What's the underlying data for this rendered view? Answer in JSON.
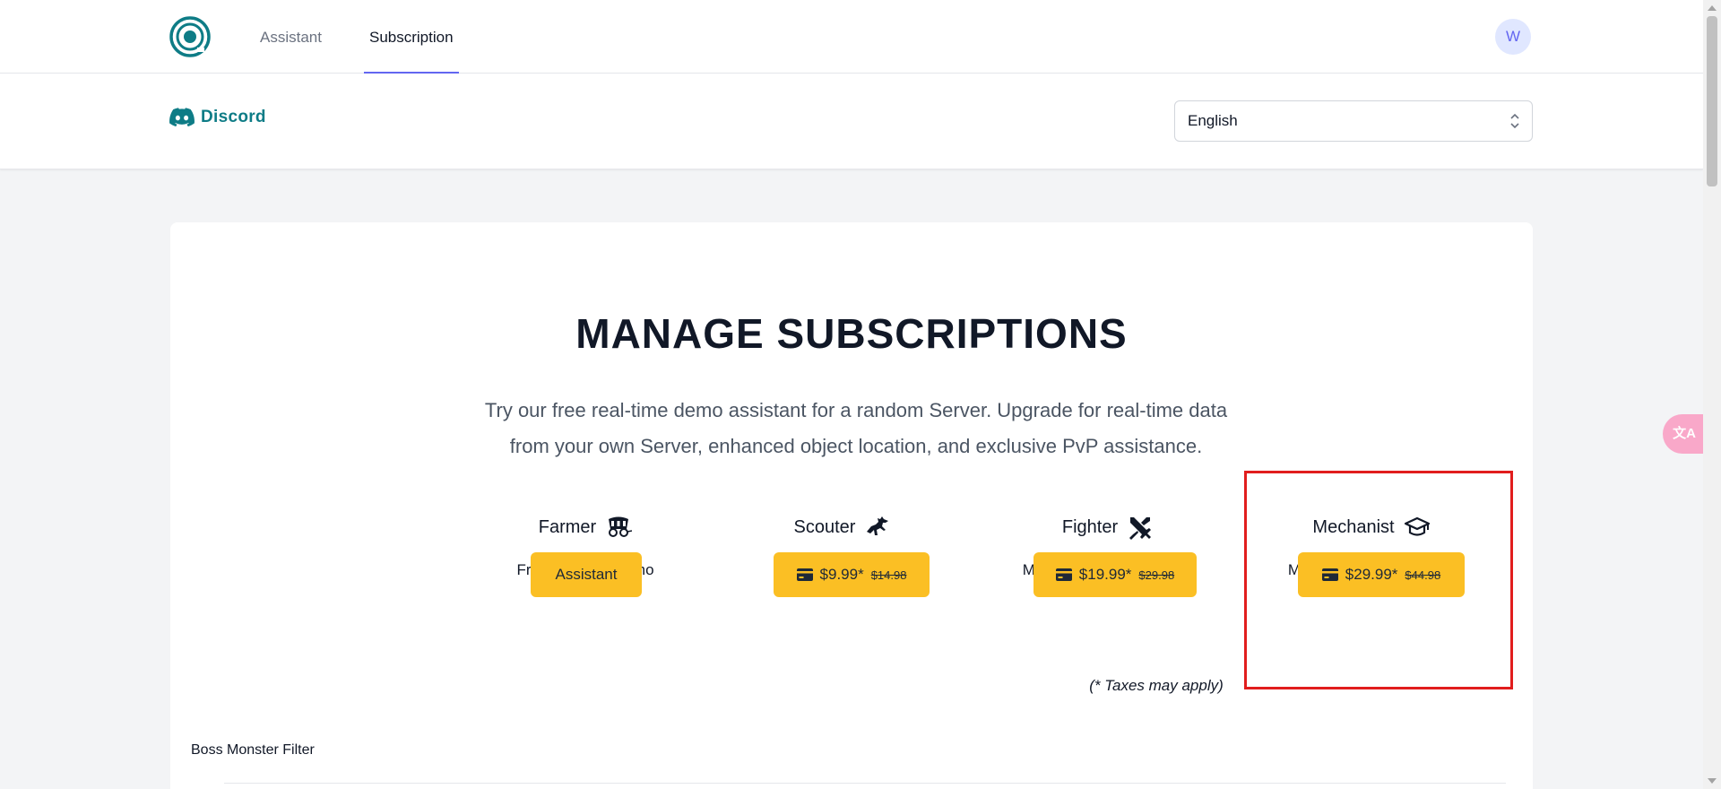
{
  "nav": {
    "tabs": [
      {
        "label": "Assistant"
      },
      {
        "label": "Subscription"
      }
    ],
    "avatar_initial": "W"
  },
  "subbar": {
    "discord_label": "Discord",
    "language": {
      "value": "English"
    }
  },
  "main": {
    "title": "MANAGE SUBSCRIPTIONS",
    "description": "Try our free real-time demo assistant for a random Server. Upgrade for real-time data from your own Server, enhanced object location, and exclusive PvP assistance.",
    "plans": [
      {
        "name": "Farmer",
        "icon": "wagon-icon",
        "subtitle": "Free real-time demo",
        "button_label": "Assistant"
      },
      {
        "name": "Scouter",
        "icon": "horse-rider-icon",
        "subtitle": "Monthly subscription",
        "price": "$9.99*",
        "old_price": "$14.98"
      },
      {
        "name": "Fighter",
        "icon": "crossed-swords-icon",
        "subtitle": "Monthly PvP subscription",
        "price": "$19.99*",
        "old_price": "$29.98"
      },
      {
        "name": "Mechanist",
        "icon": "graduation-cap-icon",
        "subtitle": "Monthly API subscription",
        "price": "$29.99*",
        "old_price": "$44.98"
      }
    ],
    "taxes_note": "(* Taxes may apply)",
    "filter_label": "Boss Monster Filter"
  },
  "colors": {
    "accent": "#6366f1",
    "button": "#fbbf24",
    "brand": "#0e7c86",
    "highlight": "#e11d1d"
  }
}
